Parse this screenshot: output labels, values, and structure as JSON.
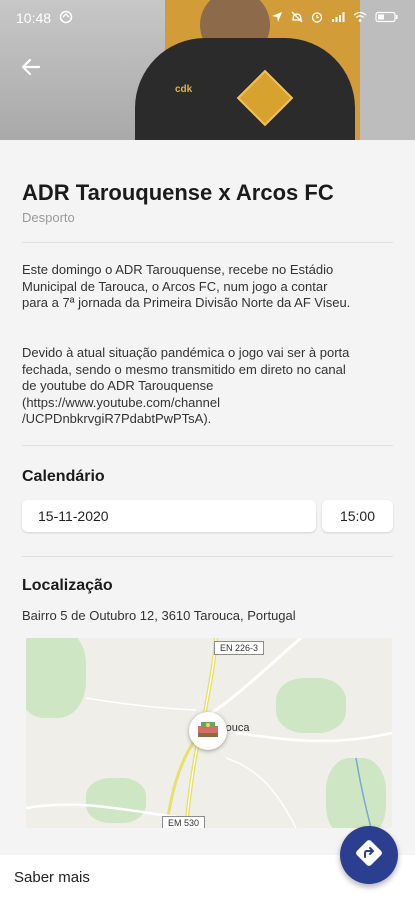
{
  "status": {
    "time": "10:48"
  },
  "event": {
    "title": "ADR Tarouquense x Arcos FC",
    "category": "Desporto",
    "paragraph1_lines": [
      "Este domingo o ADR Tarouquense, recebe no Estádio",
      "Municipal de Tarouca, o Arcos FC, num jogo a contar",
      "para a 7ª jornada da Primeira Divisão Norte da AF Viseu."
    ],
    "paragraph2_lines": [
      "Devido à atual situação pandémica o jogo vai ser à porta",
      "fechada, sendo o mesmo transmitido em direto no canal",
      "de youtube do ADR Tarouquense",
      "(https://www.youtube.com/channel",
      "/UCPDnbkrvgiR7PdabtPwPTsA)."
    ]
  },
  "calendar": {
    "heading": "Calendário",
    "date": "15-11-2020",
    "time": "15:00"
  },
  "location": {
    "heading": "Localização",
    "address": "Bairro 5 de Outubro 12, 3610 Tarouca, Portugal"
  },
  "map": {
    "road_labels": [
      "EN 226-3",
      "EM 530"
    ],
    "place_label": "rouca"
  },
  "hero": {
    "sponsor": "cdk"
  },
  "bottom": {
    "link_label": "Saber mais"
  },
  "colors": {
    "fab": "#2c3e8f",
    "hero_accent": "#d59a2a"
  }
}
